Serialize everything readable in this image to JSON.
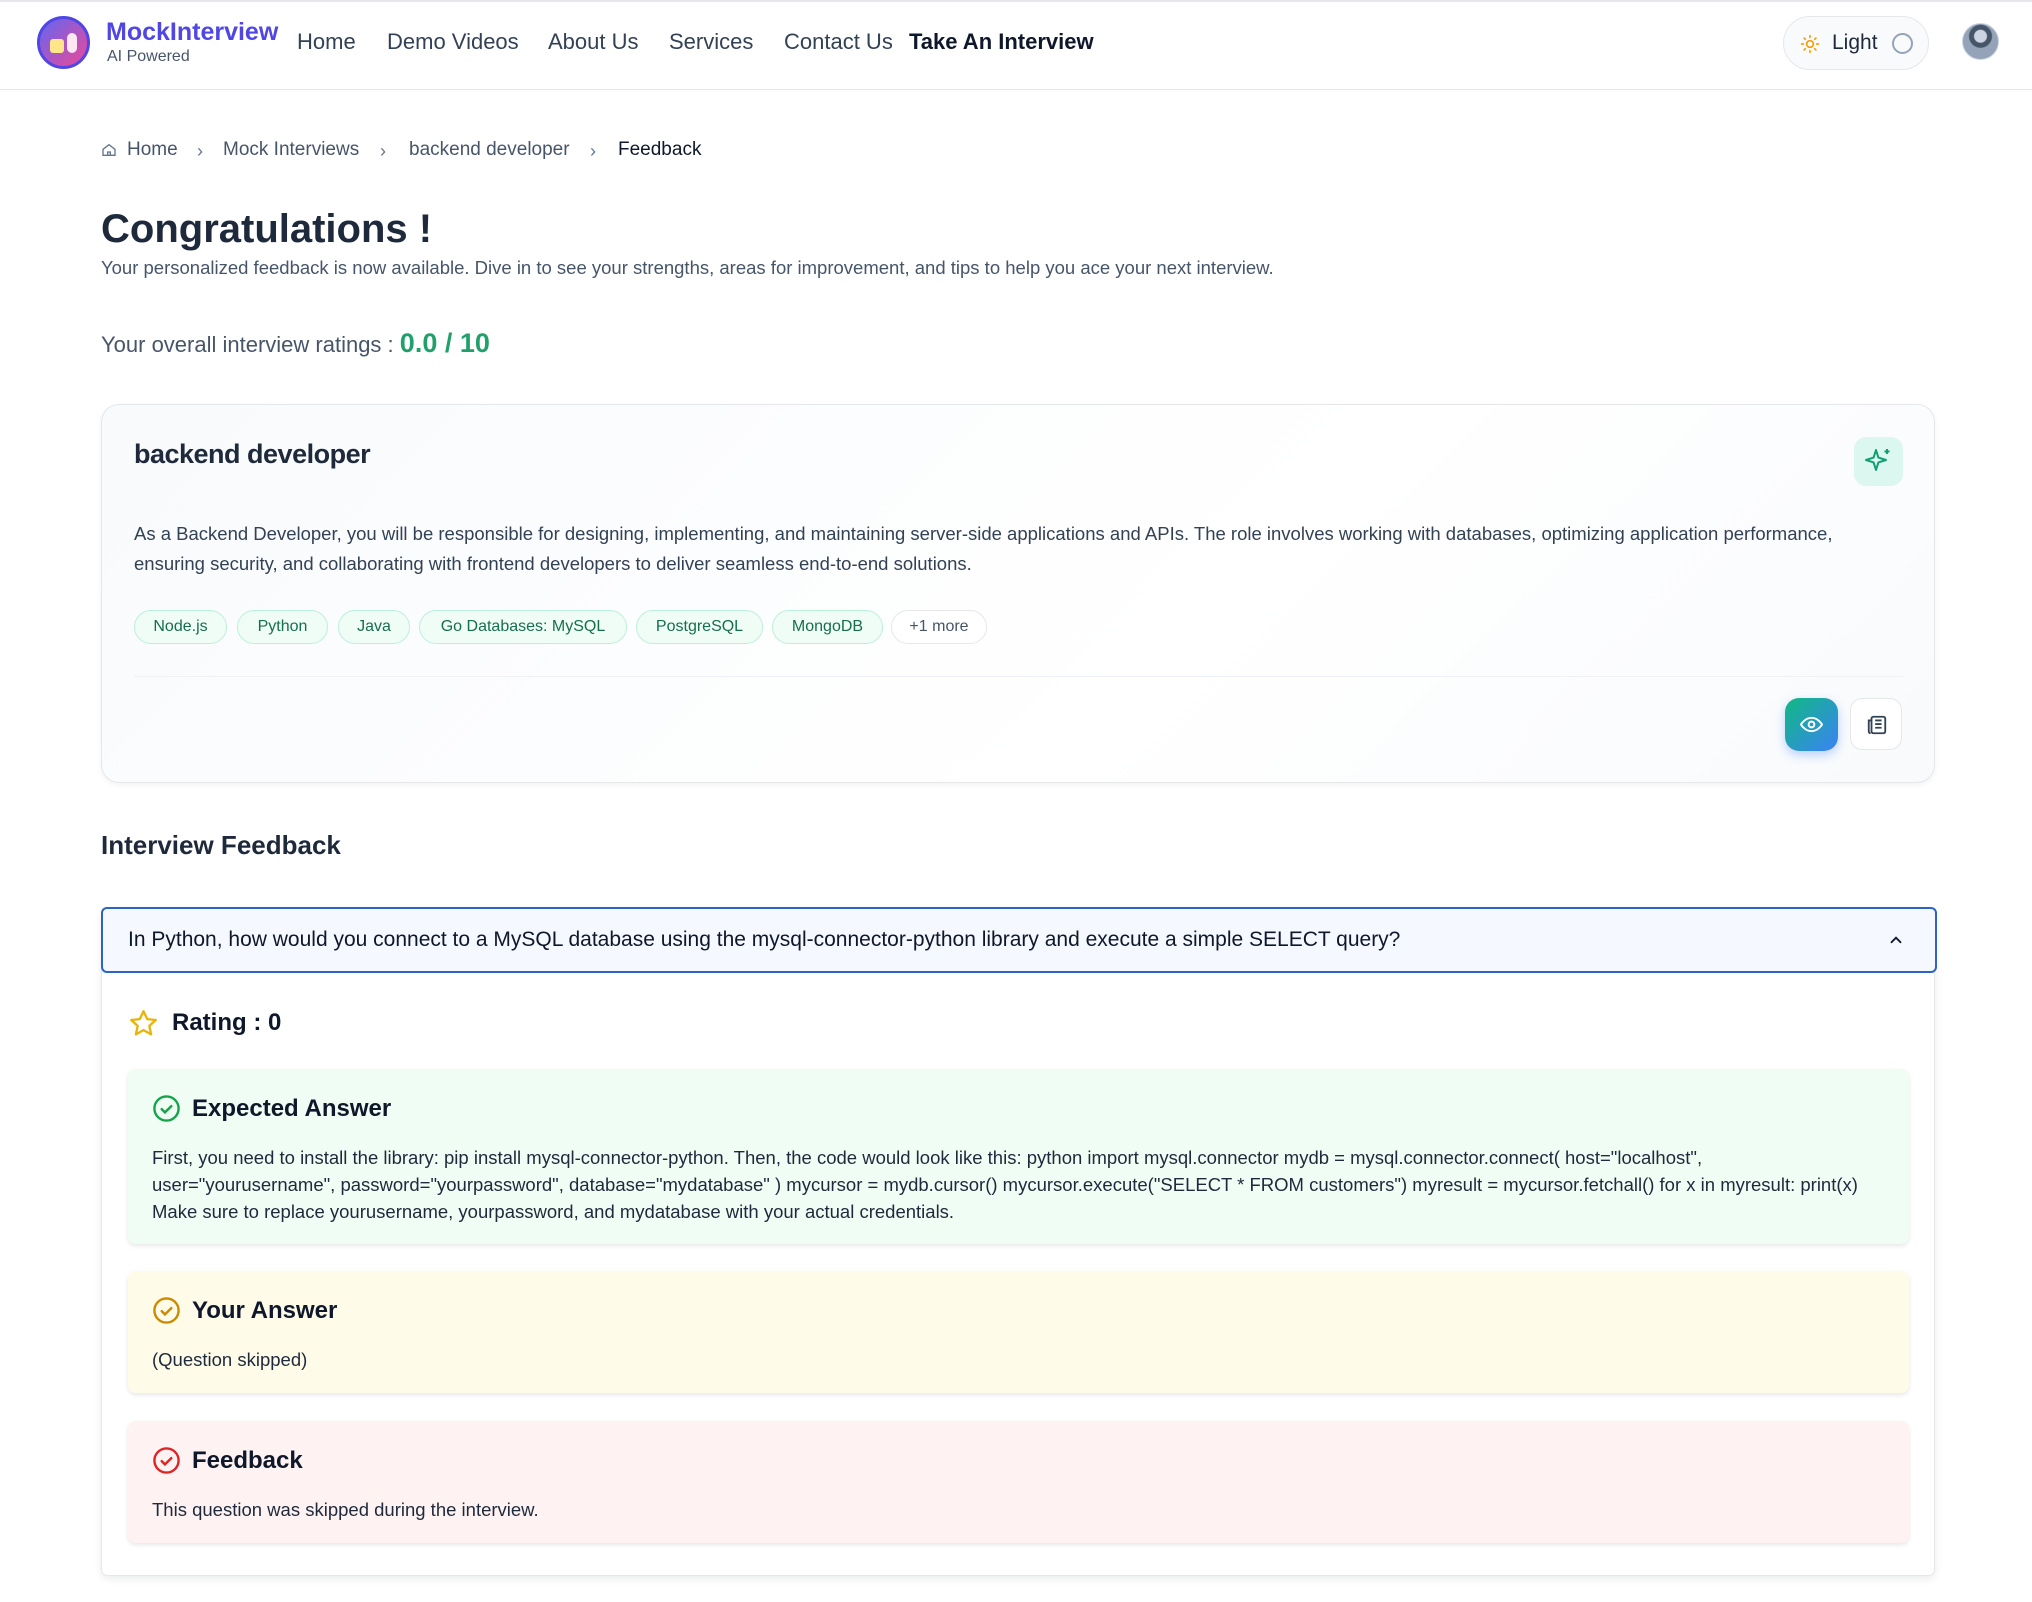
{
  "brand": {
    "name": "MockInterview",
    "tagline": "AI Powered"
  },
  "nav": {
    "items": [
      "Home",
      "Demo Videos",
      "About Us",
      "Services",
      "Contact Us"
    ],
    "cta": "Take An Interview"
  },
  "theme": {
    "label": "Light",
    "icon": "sun-icon"
  },
  "breadcrumb": [
    "Home",
    "Mock Interviews",
    "backend developer",
    "Feedback"
  ],
  "header": {
    "title": "Congratulations !",
    "subtitle": "Your personalized feedback is now available. Dive in to see your strengths, areas for improvement, and tips to help you ace your next interview.",
    "rating_label": "Your overall interview ratings :",
    "rating_value": "0.0 / 10"
  },
  "job": {
    "title": "backend developer",
    "description": "As a Backend Developer, you will be responsible for designing, implementing, and maintaining server-side applications and APIs. The role involves working with databases, optimizing application performance, ensuring security, and collaborating with frontend developers to deliver seamless end-to-end solutions.",
    "tags": [
      "Node.js",
      "Python",
      "Java",
      "Go Databases: MySQL",
      "PostgreSQL",
      "MongoDB"
    ],
    "more": "+1 more"
  },
  "feedback": {
    "section_title": "Interview Feedback",
    "question": "In Python, how would you connect to a MySQL database using the mysql-connector-python library and execute a simple SELECT query?",
    "rating": "Rating : 0",
    "expected_title": "Expected Answer",
    "expected_body": "First, you need to install the library: pip install mysql-connector-python. Then, the code would look like this: python import mysql.connector mydb = mysql.connector.connect( host=\"localhost\", user=\"yourusername\", password=\"yourpassword\", database=\"mydatabase\" ) mycursor = mydb.cursor() mycursor.execute(\"SELECT * FROM customers\") myresult = mycursor.fetchall() for x in myresult: print(x) Make sure to replace yourusername, yourpassword, and mydatabase with your actual credentials.",
    "your_title": "Your Answer",
    "your_body": "(Question skipped)",
    "feedback_title": "Feedback",
    "feedback_body": "This question was skipped during the interview."
  },
  "colors": {
    "brand": "#4f46e5",
    "rating": "#22a06b",
    "question_border": "#2b64c8",
    "expected_bg": "#f0fdf4",
    "your_bg": "#fefce8",
    "feedback_bg": "#fef2f2"
  }
}
